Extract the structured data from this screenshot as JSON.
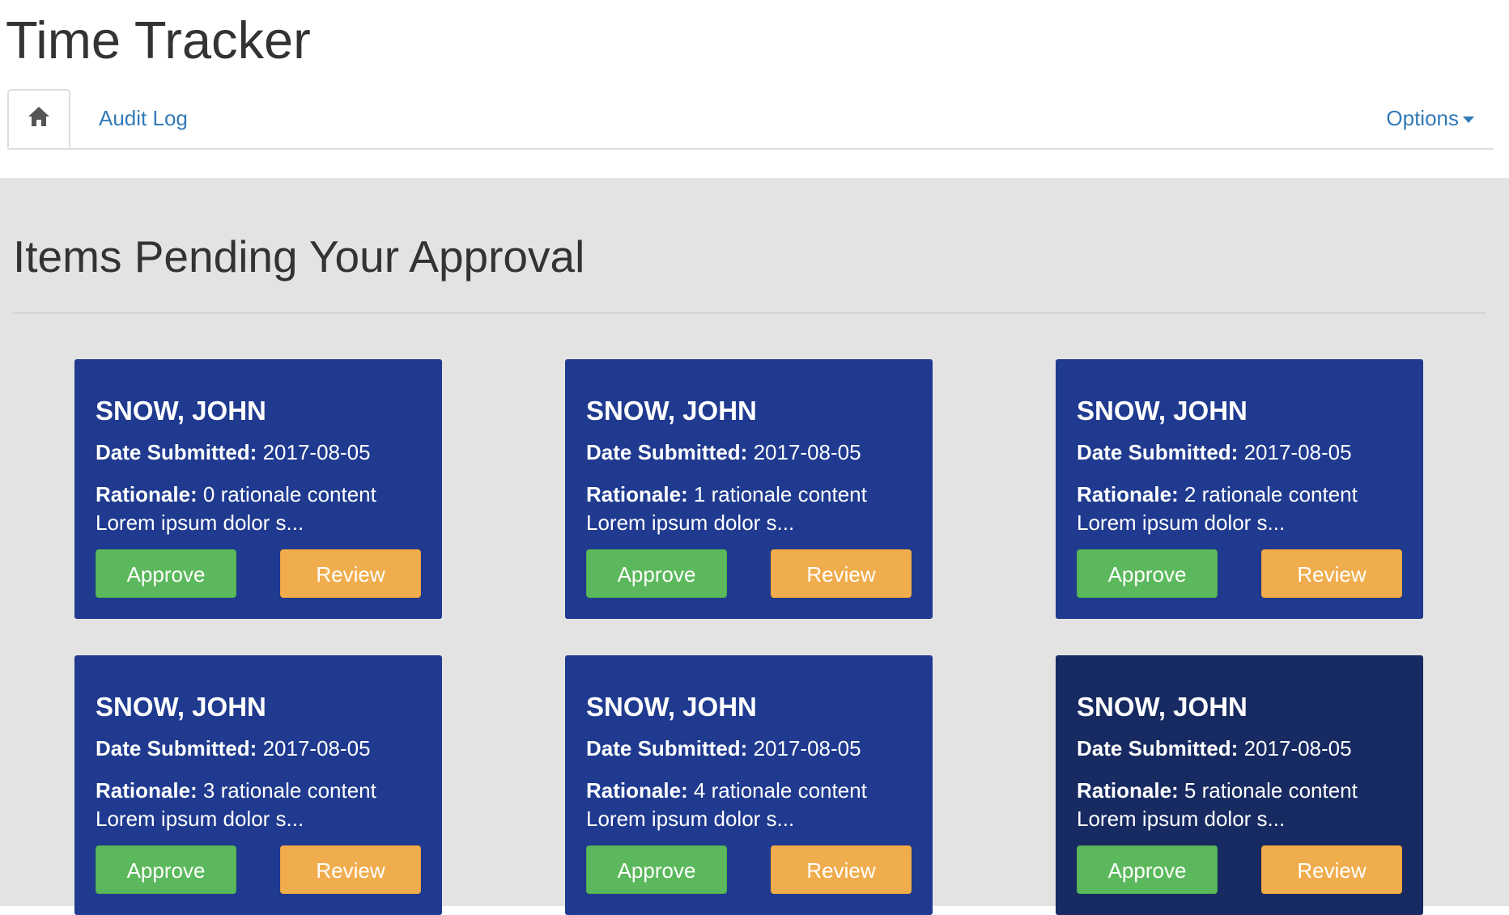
{
  "app": {
    "title": "Time Tracker"
  },
  "nav": {
    "home_icon": "home-icon",
    "audit_log_label": "Audit Log",
    "options_label": "Options"
  },
  "main": {
    "title": "Items Pending Your Approval",
    "cards": [
      {
        "name": "SNOW, JOHN",
        "date_label": "Date Submitted:",
        "date": "2017-08-05",
        "rationale_label": "Rationale:",
        "rationale": "0 rationale content",
        "lorem": "Lorem ipsum dolor s...",
        "approve_label": "Approve",
        "review_label": "Review"
      },
      {
        "name": "SNOW, JOHN",
        "date_label": "Date Submitted:",
        "date": "2017-08-05",
        "rationale_label": "Rationale:",
        "rationale": "1 rationale content",
        "lorem": "Lorem ipsum dolor s...",
        "approve_label": "Approve",
        "review_label": "Review"
      },
      {
        "name": "SNOW, JOHN",
        "date_label": "Date Submitted:",
        "date": "2017-08-05",
        "rationale_label": "Rationale:",
        "rationale": "2 rationale content",
        "lorem": "Lorem ipsum dolor s...",
        "approve_label": "Approve",
        "review_label": "Review"
      },
      {
        "name": "SNOW, JOHN",
        "date_label": "Date Submitted:",
        "date": "2017-08-05",
        "rationale_label": "Rationale:",
        "rationale": "3 rationale content",
        "lorem": "Lorem ipsum dolor s...",
        "approve_label": "Approve",
        "review_label": "Review"
      },
      {
        "name": "SNOW, JOHN",
        "date_label": "Date Submitted:",
        "date": "2017-08-05",
        "rationale_label": "Rationale:",
        "rationale": "4 rationale content",
        "lorem": "Lorem ipsum dolor s...",
        "approve_label": "Approve",
        "review_label": "Review"
      },
      {
        "name": "SNOW, JOHN",
        "date_label": "Date Submitted:",
        "date": "2017-08-05",
        "rationale_label": "Rationale:",
        "rationale": "5 rationale content",
        "lorem": "Lorem ipsum dolor s...",
        "approve_label": "Approve",
        "review_label": "Review"
      }
    ]
  },
  "colors": {
    "card_bg": "#1f3a8f",
    "card_bg_hover": "#172a61",
    "approve": "#5cb85c",
    "review": "#f0ad4e",
    "link": "#337ab7",
    "content_bg": "#e3e3e3"
  }
}
